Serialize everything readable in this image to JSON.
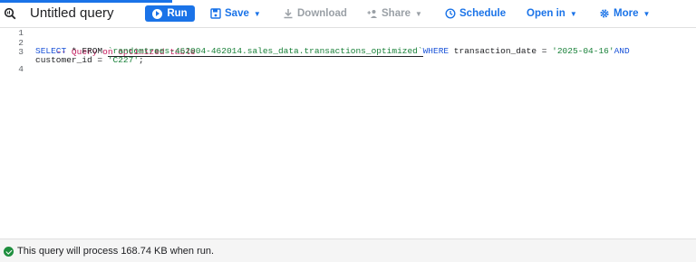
{
  "toolbar": {
    "title": "Untitled query",
    "run_label": "Run",
    "save_label": "Save",
    "download_label": "Download",
    "share_label": "Share",
    "schedule_label": "Schedule",
    "open_in_label": "Open in",
    "more_label": "More"
  },
  "editor": {
    "line_numbers": [
      "1",
      "2",
      "3",
      "",
      "4"
    ],
    "comment": "-- Query on optimized table",
    "line3": {
      "kw_select": "SELECT",
      "star_from": " * FROM ",
      "table_ref": "`randomtrees-462004-462014.sales_data.transactions_optimized`",
      "kw_where": "WHERE",
      "cond1": " transaction_date = ",
      "date_value": "'2025-04-16'",
      "kw_and": "AND"
    },
    "line3_wrap": {
      "col": "customer_id = ",
      "value": "'C227'",
      "end": ";"
    }
  },
  "status": {
    "text": "This query will process 168.74 KB when run."
  },
  "colors": {
    "accent": "#1a73e8",
    "comment": "#c2185b",
    "keyword": "#1a53d8",
    "string": "#188038",
    "success": "#1e8e3e"
  }
}
